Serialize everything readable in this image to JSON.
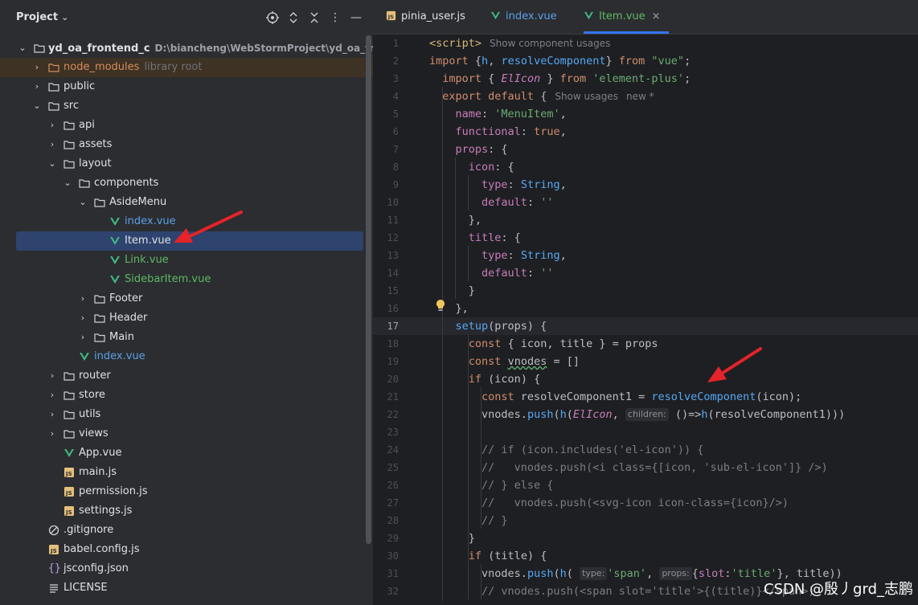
{
  "project_panel": {
    "title": "Project",
    "tree": [
      {
        "label": "yd_oa_frontend_c",
        "path": "D:\\biancheng\\WebStormProject\\yd_oa_frontend_c",
        "type": "root"
      },
      {
        "label": "node_modules",
        "hint": "library root",
        "type": "folder-nm"
      },
      {
        "label": "public",
        "type": "folder"
      },
      {
        "label": "src",
        "type": "folder"
      },
      {
        "label": "api",
        "type": "folder"
      },
      {
        "label": "assets",
        "type": "folder"
      },
      {
        "label": "layout",
        "type": "folder"
      },
      {
        "label": "components",
        "type": "folder"
      },
      {
        "label": "AsideMenu",
        "type": "folder"
      },
      {
        "label": "index.vue",
        "type": "vue"
      },
      {
        "label": "Item.vue",
        "type": "vue"
      },
      {
        "label": "Link.vue",
        "type": "vue"
      },
      {
        "label": "SidebarItem.vue",
        "type": "vue"
      },
      {
        "label": "Footer",
        "type": "folder"
      },
      {
        "label": "Header",
        "type": "folder"
      },
      {
        "label": "Main",
        "type": "folder"
      },
      {
        "label": "index.vue",
        "type": "vue"
      },
      {
        "label": "router",
        "type": "folder"
      },
      {
        "label": "store",
        "type": "folder"
      },
      {
        "label": "utils",
        "type": "folder"
      },
      {
        "label": "views",
        "type": "folder"
      },
      {
        "label": "App.vue",
        "type": "vue"
      },
      {
        "label": "main.js",
        "type": "js"
      },
      {
        "label": "permission.js",
        "type": "js"
      },
      {
        "label": "settings.js",
        "type": "js"
      },
      {
        "label": ".gitignore",
        "type": "ignore"
      },
      {
        "label": "babel.config.js",
        "type": "js"
      },
      {
        "label": "jsconfig.json",
        "type": "json"
      },
      {
        "label": "LICENSE",
        "type": "license"
      }
    ]
  },
  "editor": {
    "tabs": [
      {
        "label": "pinia_user.js",
        "type": "js"
      },
      {
        "label": "index.vue",
        "type": "vue"
      },
      {
        "label": "Item.vue",
        "type": "vue",
        "close": "×"
      }
    ],
    "line_numbers": [
      "1",
      "2",
      "3",
      "4",
      "5",
      "6",
      "7",
      "8",
      "9",
      "10",
      "11",
      "12",
      "13",
      "14",
      "15",
      "16",
      "17",
      "18",
      "19",
      "20",
      "21",
      "22",
      "23",
      "24",
      "25",
      "26",
      "27",
      "28",
      "29",
      "30",
      "31",
      "32"
    ],
    "current_line": "17",
    "code": {
      "l1_tag": "<script>",
      "l1_lens": "Show component usages",
      "l2_import": "import",
      "l2_h": "h",
      "l2_rc": "resolveComponent",
      "l2_from": "from",
      "l2_mod": "\"vue\"",
      "l3_import": "import",
      "l3_elicon": "ElIcon",
      "l3_from": "from",
      "l3_mod": "'element-plus'",
      "l4_export": "export default",
      "l4_lens": "Show usages",
      "l4_new": "new *",
      "l5_name": "name",
      "l5_val": "'MenuItem'",
      "l6_func": "functional",
      "l6_val": "true",
      "l7_props": "props",
      "l8_icon": "icon",
      "l9_type": "type",
      "l9_val": "String",
      "l10_default": "default",
      "l10_val": "''",
      "l12_title": "title",
      "l13_type": "type",
      "l13_val": "String",
      "l14_default": "default",
      "l14_val": "''",
      "l17_setup": "setup",
      "l17_rest": "(props) {",
      "l18_const": "const",
      "l18_rest": " { icon, title } = props",
      "l19_const": "const",
      "l19_vnodes": "vnodes",
      "l19_rest": " = []",
      "l20_if": "if",
      "l20_rest": " (icon) {",
      "l21_const": "const",
      "l21_var": " resolveComponent1 = ",
      "l21_fn": "resolveComponent",
      "l21_rest": "(icon);",
      "l22_vnodes": "vnodes.",
      "l22_push": "push",
      "l22_h": "h",
      "l22_elicon": "ElIcon",
      "l22_hint": "children:",
      "l22_arrow": " ()=>",
      "l22_h2": "h",
      "l22_rest": "(resolveComponent1)))",
      "l24": "// if (icon.includes('el-icon')) {",
      "l25": "//   vnodes.push(<i class={[icon, 'sub-el-icon']} />)",
      "l26": "// } else {",
      "l27": "//   vnodes.push(<svg-icon icon-class={icon}/>)",
      "l28": "// }",
      "l30_if": "if",
      "l30_rest": " (title) {",
      "l31_vnodes": "vnodes.",
      "l31_push": "push",
      "l31_h": "h",
      "l31_hint1": "type:",
      "l31_span": "'span'",
      "l31_hint2": "props:",
      "l31_slot": "slot",
      "l31_title": "'title'",
      "l31_rest": "}, title))",
      "l32": "// vnodes.push(<span slot='title'>{(title)}</span>)"
    }
  },
  "watermark": "CSDN @殷丿grd_志鹏",
  "colors": {
    "accent": "#3574f0",
    "arrow": "#e5232a",
    "vue": "#41b883",
    "js": "#e5c07b"
  }
}
